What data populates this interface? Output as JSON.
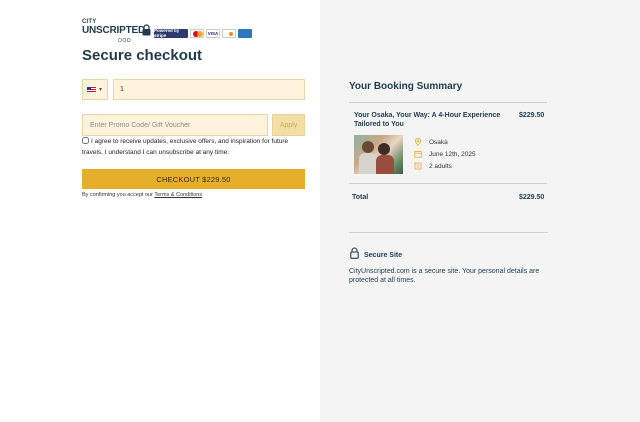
{
  "brand": {
    "line1": "CITY",
    "line2": "UNSCRIPTED",
    "line3": "OOO"
  },
  "payment_badges": [
    "Powered by stripe",
    "mastercard",
    "VISA",
    "discover",
    "amex"
  ],
  "page_title": "Secure checkout",
  "phone": {
    "country": "US",
    "value": "1"
  },
  "promo": {
    "placeholder": "Enter Promo Code/ Gift Voucher",
    "apply_label": "Apply"
  },
  "consent_text": "I agree to receive updates, exclusive offers, and inspiration for future travels. I understand I can unsubscribe at any time.",
  "checkout_label": "CHECKOUT $229.50",
  "terms": {
    "prefix": "By confirming you accept our",
    "link": "Terms & Conditions"
  },
  "summary": {
    "title": "Your Booking Summary",
    "tour_title": "Your Osaka, Your Way: A 4-Hour Experience Tailored to You",
    "tour_price": "$229.50",
    "location": "Osaka",
    "date": "June 12th, 2025",
    "guests": "2 adults",
    "total_label": "Total",
    "total_value": "$229.50"
  },
  "secure": {
    "title": "Secure Site",
    "text": "CityUnscripted.com is a secure site. Your personal details are protected at all times."
  },
  "colors": {
    "accent": "#e5ae2b",
    "brand": "#1f3b4d",
    "field_bg": "#fdf3dc",
    "panel_bg": "#f4f4f4"
  }
}
